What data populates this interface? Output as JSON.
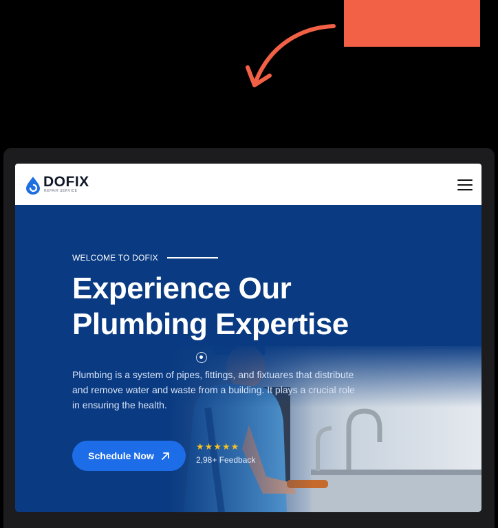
{
  "annotation": {
    "callout_color": "#f26145",
    "arrow_color": "#f26145"
  },
  "header": {
    "logo_name": "DOFIX",
    "logo_tagline": "REPAIR SERVICE",
    "menu_icon": "hamburger-icon"
  },
  "hero": {
    "eyebrow": "WELCOME TO DOFIX",
    "title_line1": "Experience Our",
    "title_line2": "Plumbing Expertise",
    "description": "Plumbing is a system of pipes, fittings, and fixtuares that distribute and remove water and waste from a building. It plays a crucial role in ensuring the health.",
    "cta_label": "Schedule Now",
    "cta_icon": "arrow-up-right-icon",
    "rating_stars": "★★★★★",
    "rating_value": 5,
    "feedback": "2,98+ Feedback"
  },
  "colors": {
    "hero_bg": "#0a3b82",
    "cta_bg": "#1d6de8",
    "star": "#f6c021",
    "logo_blue": "#1e6fe0"
  }
}
